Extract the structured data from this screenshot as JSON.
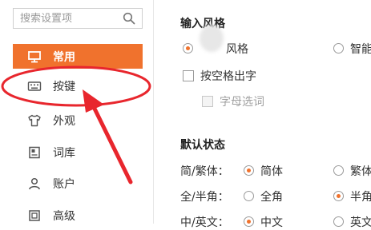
{
  "sidebar": {
    "search_placeholder": "搜索设置项",
    "items": [
      {
        "label": "常用",
        "icon": "monitor-icon",
        "active": true
      },
      {
        "label": "按键",
        "icon": "keyboard-icon",
        "active": false
      },
      {
        "label": "外观",
        "icon": "shirt-icon",
        "active": false
      },
      {
        "label": "词库",
        "icon": "book-icon",
        "active": false
      },
      {
        "label": "账户",
        "icon": "user-icon",
        "active": false
      },
      {
        "label": "高级",
        "icon": "advanced-icon",
        "active": false
      }
    ]
  },
  "input_style": {
    "title": "输入风格",
    "option1_label": "风格",
    "option2_label": "智能",
    "space_commit_label": "按空格出字",
    "letter_select_label": "字母选词"
  },
  "default_state": {
    "title": "默认状态",
    "rows": [
      {
        "label": "简/繁体：",
        "opt1": "简体",
        "opt2": "繁体"
      },
      {
        "label": "全/半角：",
        "opt1": "全角",
        "opt2": "半角"
      },
      {
        "label": "中/英文：",
        "opt1": "中文",
        "opt2": "英文"
      }
    ]
  },
  "colors": {
    "accent": "#f0722d",
    "annotation": "#e8262d"
  }
}
